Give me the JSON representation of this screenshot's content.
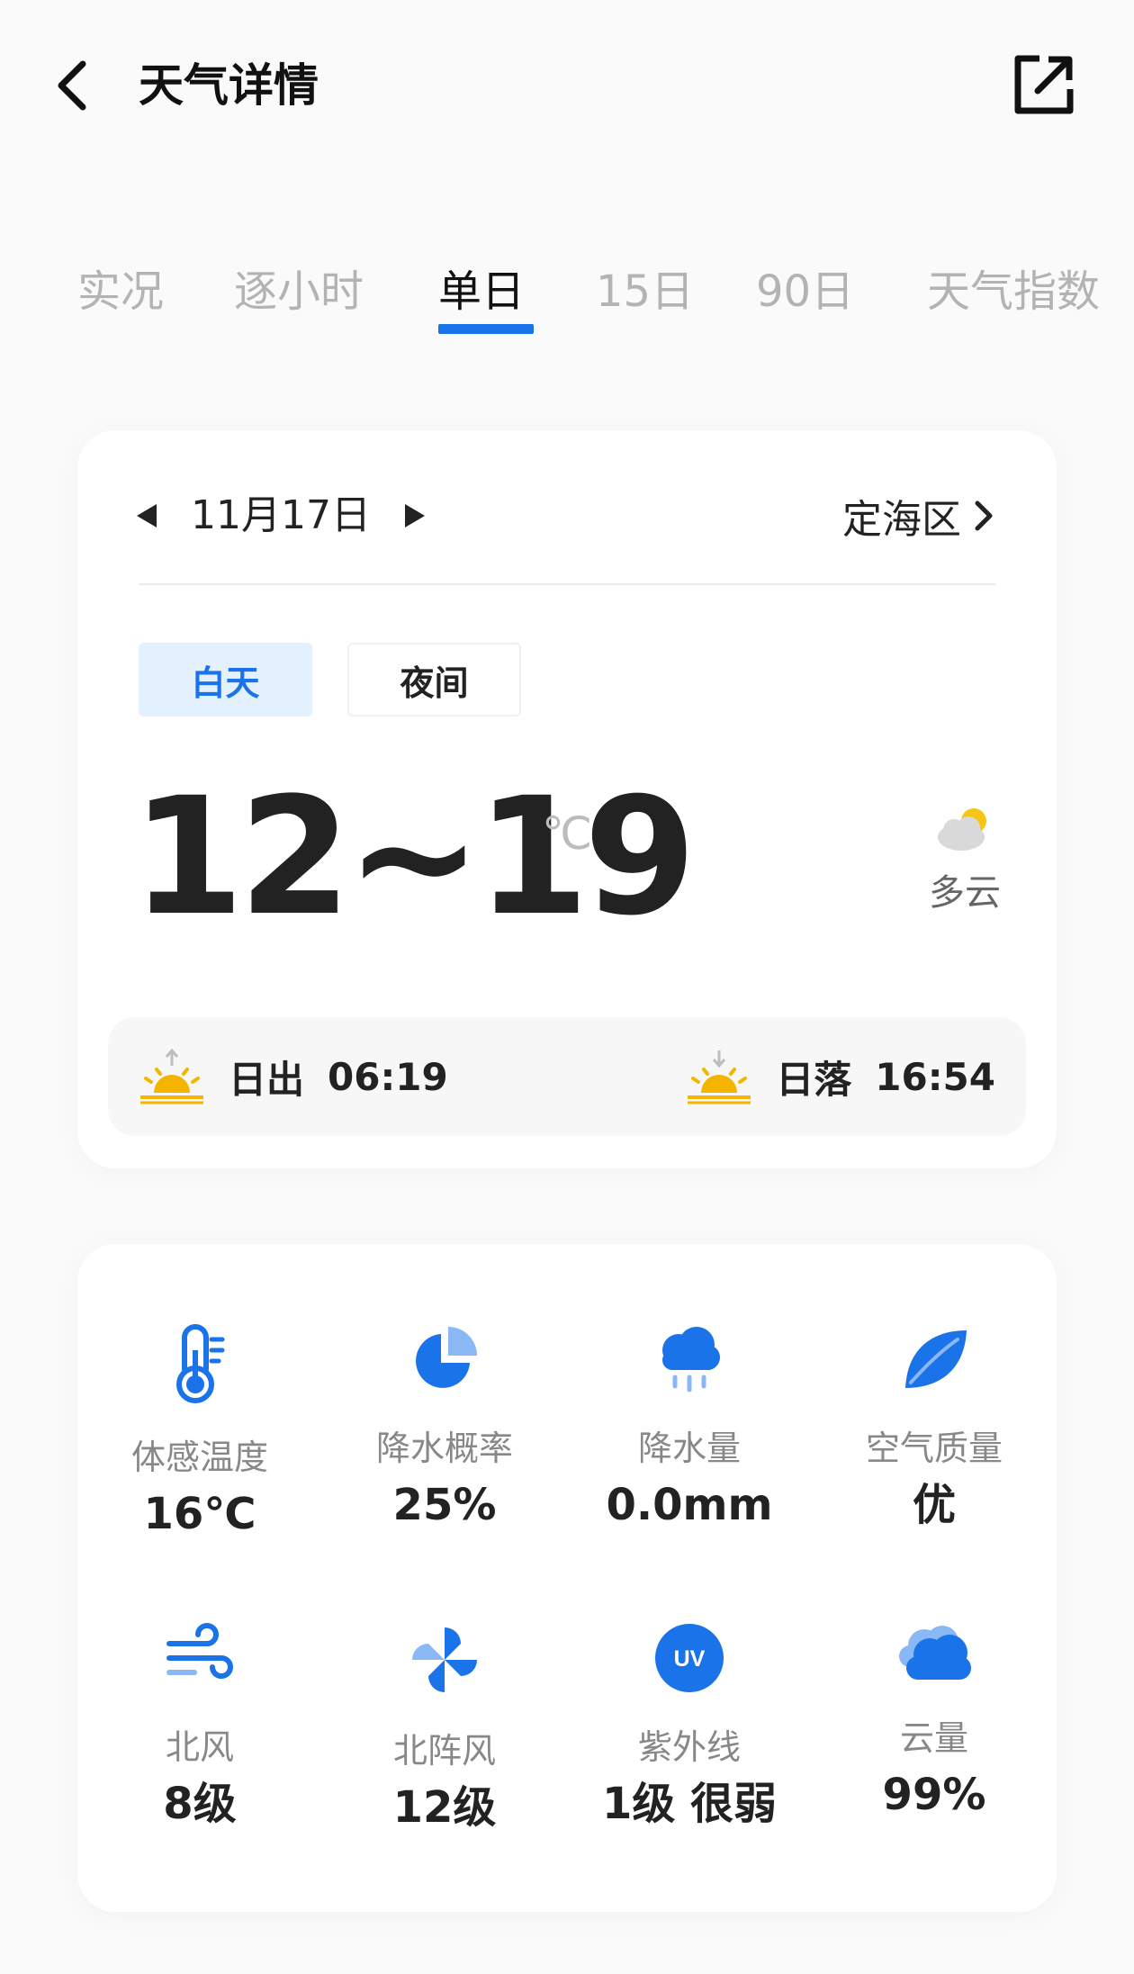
{
  "header": {
    "title": "天气详情"
  },
  "tabs": [
    {
      "label": "实况"
    },
    {
      "label": "逐小时"
    },
    {
      "label": "单日"
    },
    {
      "label": "15日"
    },
    {
      "label": "90日"
    },
    {
      "label": "天气指数"
    }
  ],
  "active_tab": "单日",
  "summary": {
    "date": "11月17日",
    "location": "定海区",
    "segments": {
      "day": "白天",
      "night": "夜间"
    },
    "temperature_range": "12~19",
    "unit": "℃",
    "condition": "多云",
    "sunrise_label": "日出",
    "sunrise_time": "06:19",
    "sunset_label": "日落",
    "sunset_time": "16:54"
  },
  "details": [
    {
      "label": "体感温度",
      "value": "16℃",
      "icon": "thermometer-icon"
    },
    {
      "label": "降水概率",
      "value": "25%",
      "icon": "pie-chart-icon"
    },
    {
      "label": "降水量",
      "value": "0.0mm",
      "icon": "rain-cloud-icon"
    },
    {
      "label": "空气质量",
      "value": "优",
      "icon": "leaf-icon"
    },
    {
      "label": "北风",
      "value": "8级",
      "icon": "wind-icon"
    },
    {
      "label": "北阵风",
      "value": "12级",
      "icon": "pinwheel-icon"
    },
    {
      "label": "紫外线",
      "value": "1级 很弱",
      "icon": "uv-icon",
      "badge": "UV"
    },
    {
      "label": "云量",
      "value": "99%",
      "icon": "cloud-icon"
    }
  ],
  "colors": {
    "accent": "#1a73e8",
    "sun": "#f5b400"
  }
}
